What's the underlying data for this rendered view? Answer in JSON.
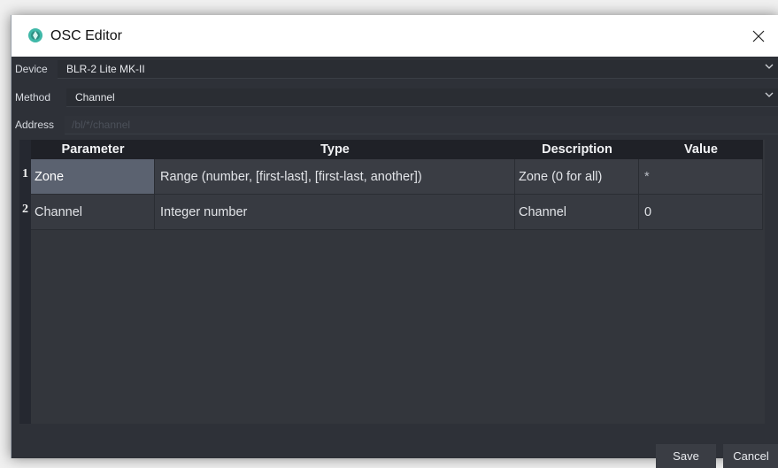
{
  "window": {
    "title": "OSC Editor",
    "close_glyph": "✕"
  },
  "form": {
    "device": {
      "label": "Device",
      "value": "BLR-2 Lite MK-II"
    },
    "method": {
      "label": "Method",
      "value": "Channel"
    },
    "address": {
      "label": "Address",
      "placeholder": "/bl/*/channel"
    }
  },
  "table": {
    "headers": [
      "Parameter",
      "Type",
      "Description",
      "Value"
    ],
    "rows": [
      {
        "num": "1",
        "parameter": "Zone",
        "type": "Range (number, [first-last], [first-last, another])",
        "description": "Zone (0 for all)",
        "value": "*"
      },
      {
        "num": "2",
        "parameter": "Channel",
        "type": "Integer number",
        "description": "Channel",
        "value": "0"
      }
    ]
  },
  "buttons": {
    "save": "Save",
    "cancel": "Cancel"
  },
  "colors": {
    "accent_icon": "#3fb8a8",
    "selected_cell": "#5b6270"
  }
}
